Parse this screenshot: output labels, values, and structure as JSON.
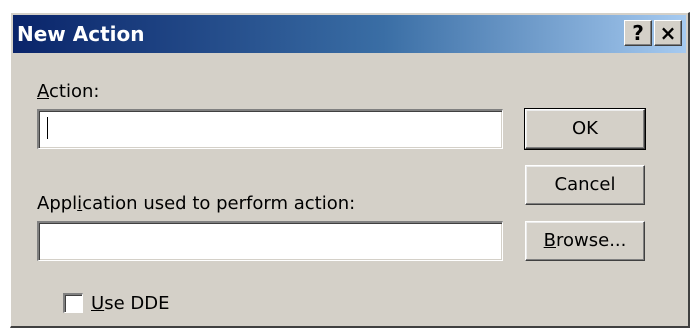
{
  "window": {
    "title": "New Action",
    "help_label": "?",
    "close_label": "×"
  },
  "action": {
    "label_mnemonic": "A",
    "label_rest": "ction:",
    "value": ""
  },
  "application": {
    "label_pre": "Appl",
    "label_mnemonic": "i",
    "label_post": "cation used to perform action:",
    "value": ""
  },
  "buttons": {
    "ok": "OK",
    "cancel": "Cancel",
    "browse_mnemonic": "B",
    "browse_rest": "rowse..."
  },
  "dde": {
    "label_mnemonic": "U",
    "label_rest": "se DDE",
    "checked": false
  }
}
